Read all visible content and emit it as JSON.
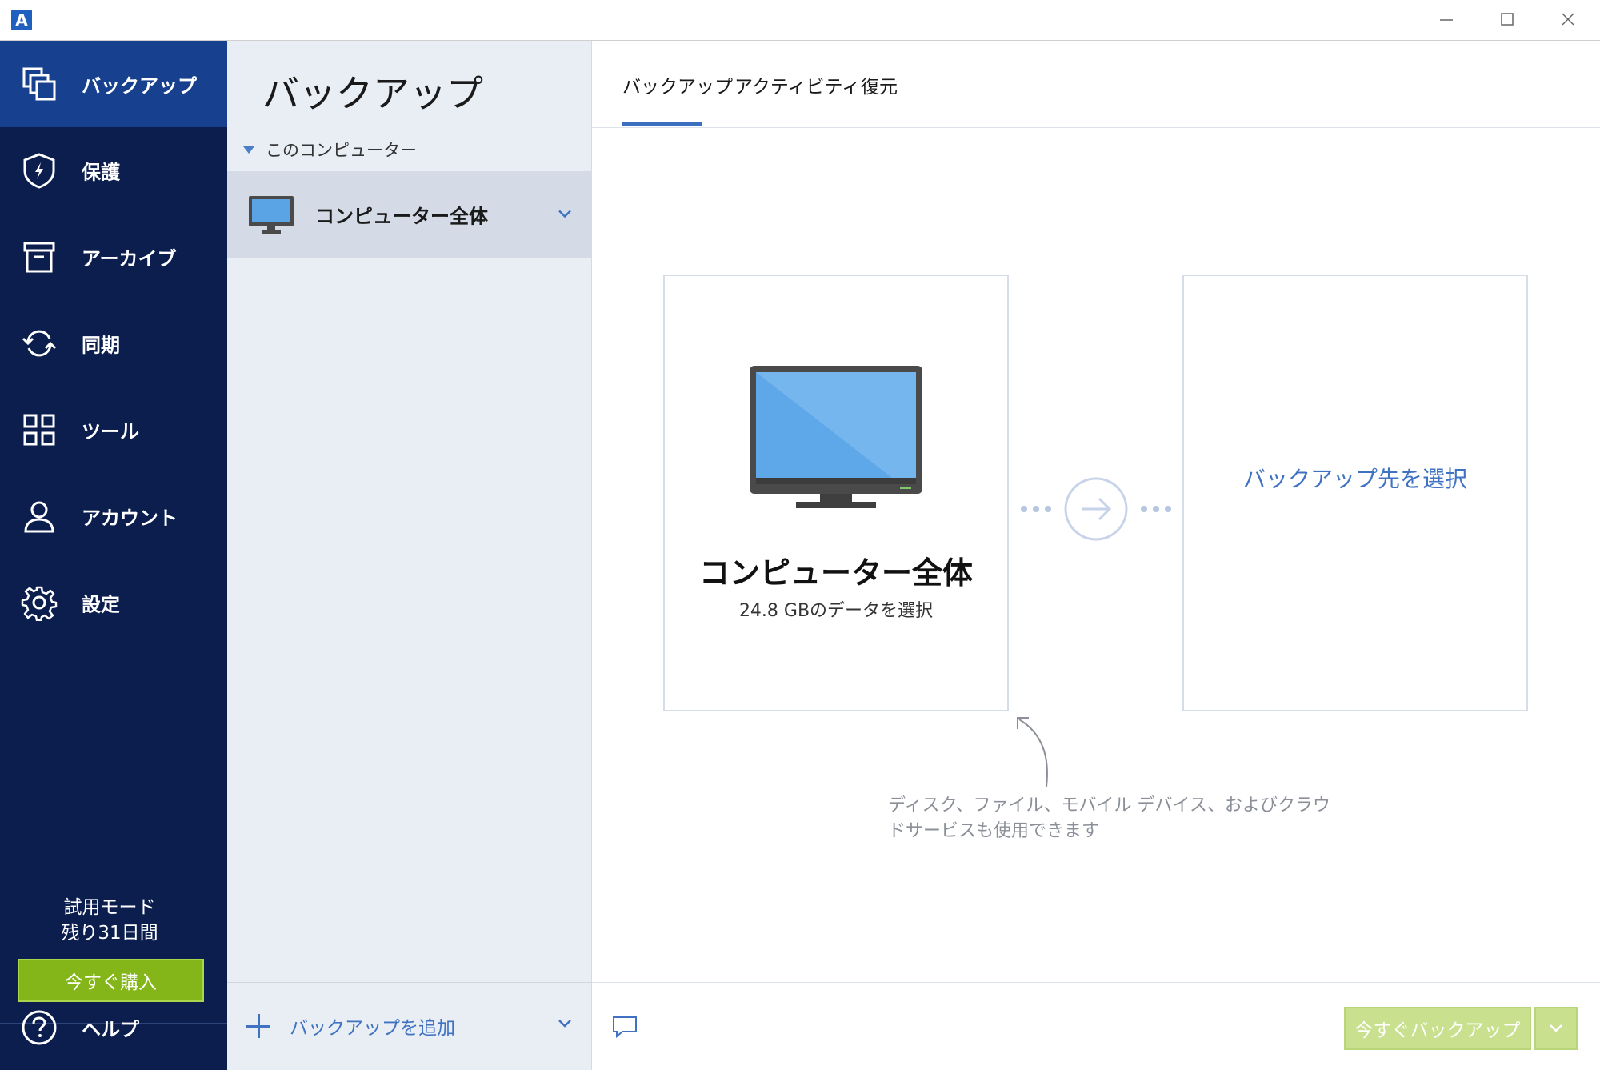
{
  "titlebar": {
    "logo_letter": "A",
    "controls": [
      "minimize",
      "maximize",
      "close"
    ]
  },
  "nav": {
    "items": [
      {
        "label": "バックアップ",
        "icon": "backup-icon",
        "active": true
      },
      {
        "label": "保護",
        "icon": "shield-icon",
        "active": false
      },
      {
        "label": "アーカイブ",
        "icon": "archive-icon",
        "active": false
      },
      {
        "label": "同期",
        "icon": "sync-icon",
        "active": false
      },
      {
        "label": "ツール",
        "icon": "tools-grid-icon",
        "active": false
      },
      {
        "label": "アカウント",
        "icon": "account-icon",
        "active": false
      },
      {
        "label": "設定",
        "icon": "gear-icon",
        "active": false
      }
    ],
    "trial_line1": "試用モード",
    "trial_line2": "残り31日間",
    "buy_label": "今すぐ購入",
    "help_label": "ヘルプ"
  },
  "mid": {
    "title": "バックアップ",
    "group_label": "このコンピューター",
    "backup_item_label": "コンピューター全体",
    "add_backup_label": "バックアップを追加"
  },
  "main": {
    "tabs": [
      {
        "label": "バックアップ",
        "active": true
      },
      {
        "label": "アクティビティ",
        "active": false
      },
      {
        "label": "復元",
        "active": false
      }
    ],
    "source_title": "コンピューター全体",
    "source_sub": "24.8 GBのデータを選択",
    "dest_label": "バックアップ先を選択",
    "hint_line1": "ディスク、ファイル、モバイル デバイス、およびクラウ",
    "hint_line2": "ドサービスも使用できます",
    "backup_now_label": "今すぐバックアップ"
  },
  "colors": {
    "nav_bg": "#0b1e4e",
    "nav_active": "#17418f",
    "accent_blue": "#3f72c2",
    "buy_green": "#85b619",
    "backup_now_green": "#c9e08f"
  }
}
